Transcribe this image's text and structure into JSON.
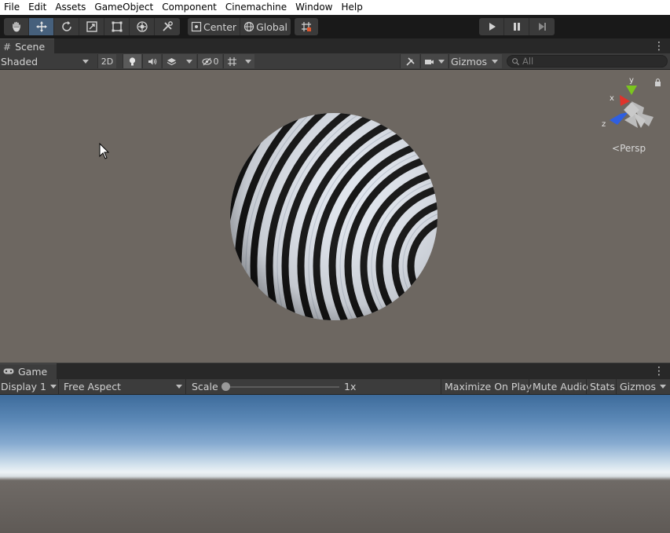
{
  "menu": [
    "File",
    "Edit",
    "Assets",
    "GameObject",
    "Component",
    "Cinemachine",
    "Window",
    "Help"
  ],
  "toolbar": {
    "tools": [
      {
        "name": "hand-tool-button",
        "icon": "hand-icon"
      },
      {
        "name": "move-tool-button",
        "icon": "move-icon",
        "active": true
      },
      {
        "name": "rotate-tool-button",
        "icon": "rotate-icon"
      },
      {
        "name": "scale-tool-button",
        "icon": "scale-icon"
      },
      {
        "name": "rect-tool-button",
        "icon": "rect-icon"
      },
      {
        "name": "transform-tool-button",
        "icon": "transform-icon"
      },
      {
        "name": "custom-tool-button",
        "icon": "tools-icon"
      }
    ],
    "pivot_label": "Center",
    "space_label": "Global"
  },
  "scene": {
    "tab_label": "Scene",
    "draw_mode": "Shaded",
    "mode_2d": "2D",
    "hidden_count": "0",
    "gizmos_label": "Gizmos",
    "search_placeholder": "All",
    "axis": {
      "x": "x",
      "y": "y",
      "z": "z"
    },
    "projection": "Persp"
  },
  "game": {
    "tab_label": "Game",
    "display": "Display 1",
    "aspect": "Free Aspect",
    "scale_label": "Scale",
    "scale_value": "1x",
    "scale_level": 0,
    "maximize_label": "Maximize On Play",
    "mute_label": "Mute Audio",
    "stats_label": "Stats",
    "gizmos_label": "Gizmos"
  },
  "colors": {
    "scene_background": "#6d6761",
    "toolbar_background": "#191919",
    "active_tool": "#46607c",
    "gizmo_x": "#e0332b",
    "gizmo_y": "#7bc51f",
    "gizmo_z": "#2f5fe0"
  }
}
